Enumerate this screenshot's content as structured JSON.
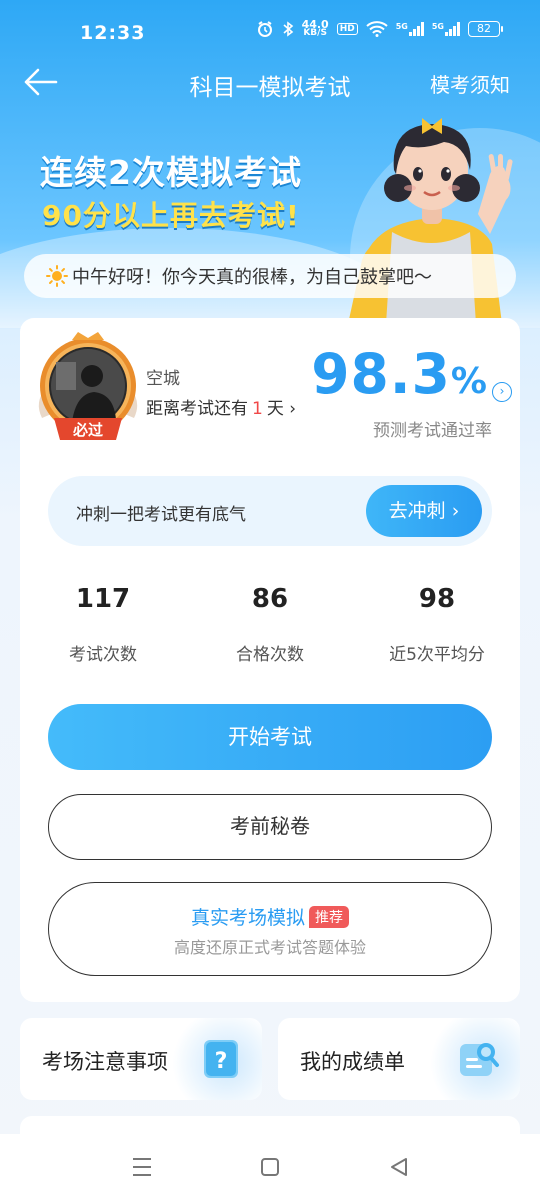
{
  "status_bar": {
    "time": "12:33",
    "speed_value": "44.0",
    "speed_unit": "KB/S",
    "hd": "HD",
    "sim1": "5G",
    "sim2": "5G",
    "battery": "82"
  },
  "nav": {
    "title": "科目一模拟考试",
    "notice": "模考须知"
  },
  "hero": {
    "line1": "连续2次模拟考试",
    "line2": "90分以上再去考试!"
  },
  "greeting": "中午好呀！你今天真的很棒，为自己鼓掌吧～",
  "profile": {
    "name": "空城",
    "badge": "必过",
    "days_prefix": "距离考试还有",
    "days": "1",
    "days_suffix": "天",
    "pass_rate_value": "98.3",
    "pass_rate_unit": "%",
    "pass_rate_label": "预测考试通过率"
  },
  "sprint": {
    "text": "冲刺一把考试更有底气",
    "button": "去冲刺"
  },
  "stats": [
    {
      "value": "117",
      "label": "考试次数"
    },
    {
      "value": "86",
      "label": "合格次数"
    },
    {
      "value": "98",
      "label": "近5次平均分"
    }
  ],
  "actions": {
    "start": "开始考试",
    "secret": "考前秘卷",
    "real_title": "真实考场模拟",
    "real_tag": "推荐",
    "real_sub": "高度还原正式考试答题体验"
  },
  "tiles": [
    {
      "label": "考场注意事项",
      "icon": "question-icon"
    },
    {
      "label": "我的成绩单",
      "icon": "report-search-icon"
    }
  ],
  "colors": {
    "primary": "#2a9cf2",
    "highlight": "#ffe24a",
    "danger": "#f04848"
  }
}
